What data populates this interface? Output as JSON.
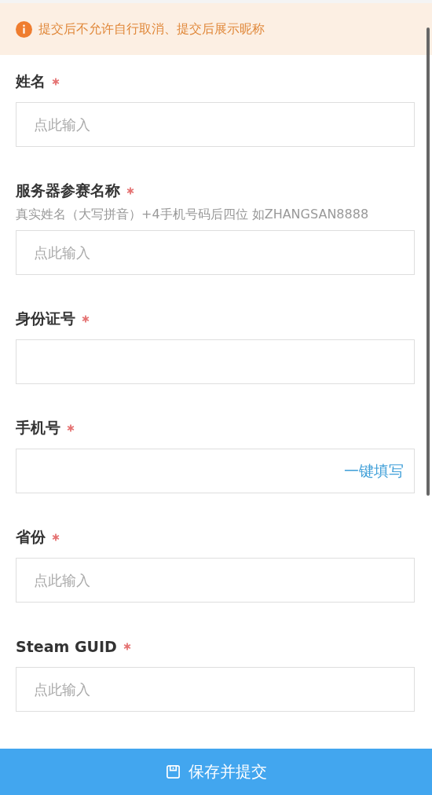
{
  "notice": {
    "text": "提交后不允许自行取消、提交后展示昵称"
  },
  "fields": [
    {
      "label": "姓名",
      "required": true,
      "placeholder": "点此输入"
    },
    {
      "label": "服务器参赛名称",
      "required": true,
      "hint": "真实姓名（大写拼音）+4手机号码后四位 如ZHANGSAN8888",
      "placeholder": "点此输入"
    },
    {
      "label": "身份证号",
      "required": true
    },
    {
      "label": "手机号",
      "required": true,
      "action": "一键填写"
    },
    {
      "label": "省份",
      "required": true,
      "placeholder": "点此输入"
    },
    {
      "label": "Steam GUID",
      "required": true,
      "placeholder": "点此输入"
    }
  ],
  "submit_button": {
    "label": "保存并提交"
  }
}
